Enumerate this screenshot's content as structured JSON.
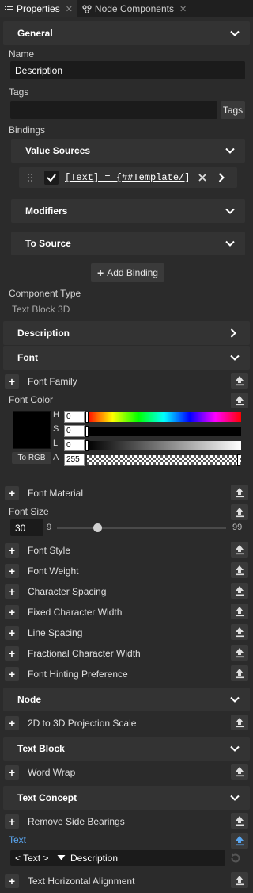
{
  "tabs": [
    {
      "label": "Properties",
      "icon": "list-icon"
    },
    {
      "label": "Node Components",
      "icon": "nodes-icon"
    }
  ],
  "general": {
    "title": "General",
    "name_label": "Name",
    "name_value": "Description",
    "tags_label": "Tags",
    "tags_value": "",
    "tags_button": "Tags",
    "bindings_label": "Bindings",
    "value_sources": "Value Sources",
    "binding_expr": "[Text] = {##Template/]",
    "binding_checked": true,
    "modifiers": "Modifiers",
    "to_source": "To Source",
    "add_binding": "Add Binding",
    "component_type_label": "Component Type",
    "component_type_value": "Text Block 3D"
  },
  "description": {
    "title": "Description"
  },
  "font": {
    "title": "Font",
    "font_family": "Font Family",
    "font_color_label": "Font Color",
    "color": {
      "h": "0",
      "s": "0",
      "l": "0",
      "a": "255",
      "swatch": "#000000"
    },
    "h_label": "H",
    "s_label": "S",
    "l_label": "L",
    "a_label": "A",
    "to_rgb": "To RGB",
    "font_material": "Font Material",
    "font_size_label": "Font Size",
    "font_size_value": "30",
    "slider_min": "9",
    "slider_max": "99",
    "slider_value": 30,
    "props": [
      "Font Style",
      "Font Weight",
      "Character Spacing",
      "Fixed Character Width",
      "Line Spacing",
      "Fractional Character Width",
      "Font Hinting Preference"
    ]
  },
  "node": {
    "title": "Node",
    "props": [
      "2D to 3D Projection Scale"
    ]
  },
  "text_block": {
    "title": "Text Block",
    "props": [
      "Word Wrap"
    ]
  },
  "text_concept": {
    "title": "Text Concept",
    "props": [
      "Remove Side Bearings"
    ],
    "text_label": "Text",
    "text_type": "< Text >",
    "text_value": "Description",
    "last_prop": "Text Horizontal Alignment"
  },
  "colors": {
    "panel_bg": "#2b2b2b",
    "section_bg": "#333333",
    "accent_blue": "#5aa6f0",
    "input_bg": "#1b1b1b"
  }
}
